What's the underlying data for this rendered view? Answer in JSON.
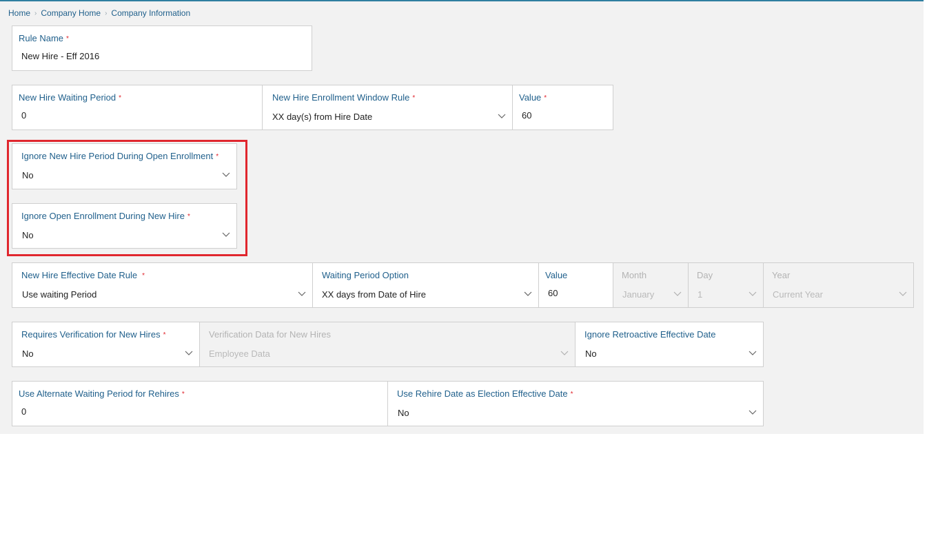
{
  "breadcrumb": {
    "items": [
      "Home",
      "Company Home",
      "Company Information"
    ]
  },
  "required_marker": "*",
  "fields": {
    "rule_name": {
      "label": "Rule Name",
      "value": "New Hire - Eff 2016"
    },
    "new_hire_waiting_period": {
      "label": "New Hire Waiting Period",
      "value": "0"
    },
    "enrollment_window_rule": {
      "label": "New Hire Enrollment Window Rule",
      "value": "XX day(s) from Hire Date"
    },
    "enrollment_window_value": {
      "label": "Value",
      "value": "60"
    },
    "ignore_nh_period_oe": {
      "label": "Ignore New Hire Period During Open Enrollment",
      "value": "No"
    },
    "ignore_oe_nh": {
      "label": "Ignore Open Enrollment During New Hire",
      "value": "No"
    },
    "effective_date_rule": {
      "label": "New Hire Effective Date Rule",
      "value": "Use waiting Period"
    },
    "waiting_period_option": {
      "label": "Waiting Period Option",
      "value": "XX days from Date of Hire"
    },
    "waiting_period_value": {
      "label": "Value",
      "value": "60"
    },
    "month": {
      "label": "Month",
      "value": "January"
    },
    "day": {
      "label": "Day",
      "value": "1"
    },
    "year": {
      "label": "Year",
      "value": "Current Year"
    },
    "requires_verification": {
      "label": "Requires Verification for New Hires",
      "value": "No"
    },
    "verification_data": {
      "label": "Verification Data for New Hires",
      "value": "Employee Data"
    },
    "ignore_retro": {
      "label": "Ignore Retroactive Effective Date",
      "value": "No"
    },
    "alt_waiting_rehires": {
      "label": "Use Alternate Waiting Period for Rehires",
      "value": "0"
    },
    "rehire_date_election": {
      "label": "Use Rehire Date as Election Effective Date",
      "value": "No"
    }
  },
  "colors": {
    "accent": "#1f5f8b",
    "required": "#e0262e",
    "highlight": "#e0262e",
    "panel": "#f2f2f2"
  }
}
